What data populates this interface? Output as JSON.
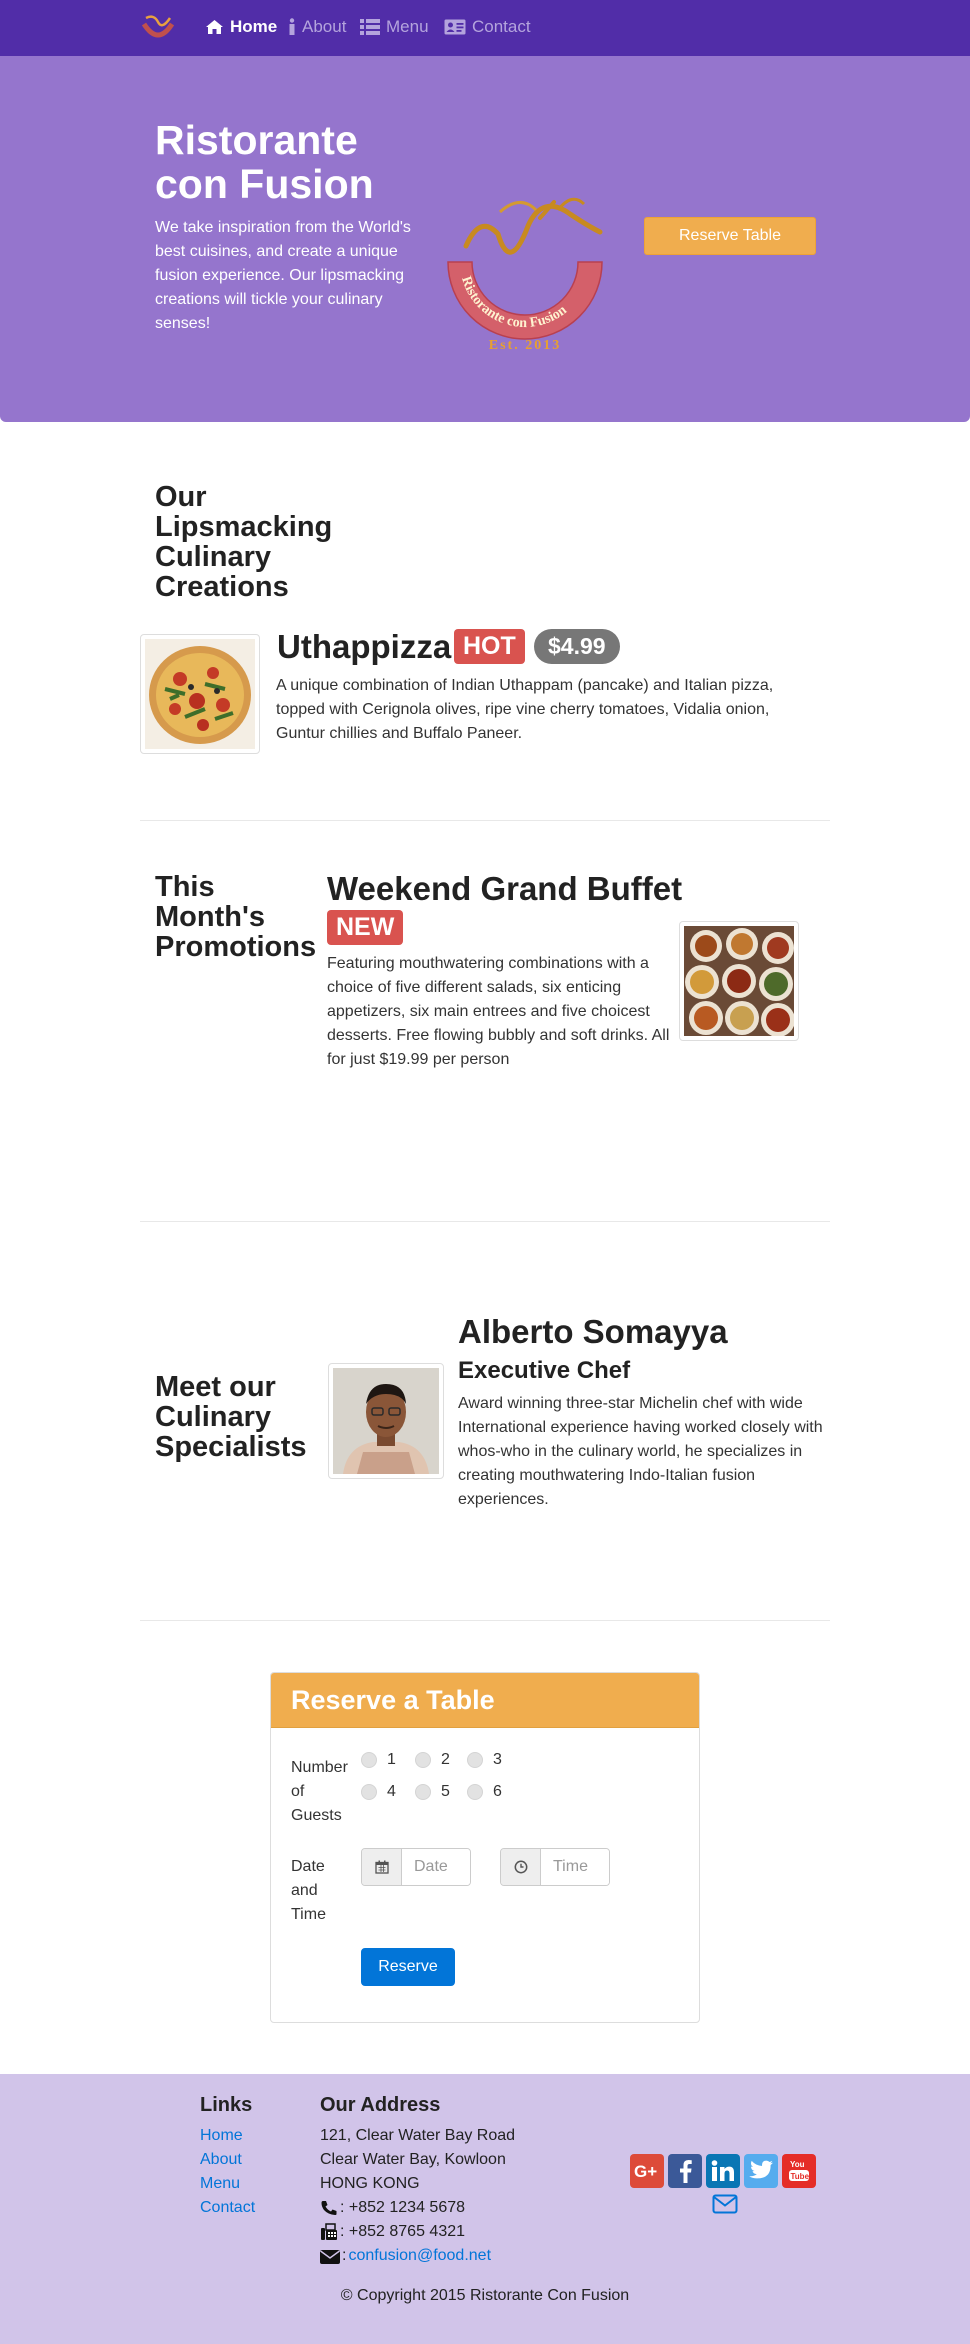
{
  "nav": {
    "items": [
      {
        "label": "Home",
        "icon": "home-icon"
      },
      {
        "label": "About",
        "icon": "info-icon"
      },
      {
        "label": "Menu",
        "icon": "list-icon"
      },
      {
        "label": "Contact",
        "icon": "address-card-icon"
      }
    ]
  },
  "jumbotron": {
    "title": "Ristorante con Fusion",
    "text": "We take inspiration from the World's best cuisines, and create a unique fusion experience. Our lipsmacking creations will tickle your culinary senses!",
    "logo_text": "Ristorante con Fusion",
    "logo_est": "Est. 2013",
    "reserve_label": "Reserve Table"
  },
  "creations": {
    "heading": "Our Lipsmacking Culinary Creations",
    "dish_name": "Uthappizza",
    "label": "HOT",
    "price": "$4.99",
    "description": "A unique combination of Indian Uthappam (pancake) and Italian pizza, topped with Cerignola olives, ripe vine cherry tomatoes, Vidalia onion, Guntur chillies and Buffalo Paneer."
  },
  "promotions": {
    "heading": "This Month's Promotions",
    "name": "Weekend Grand Buffet",
    "label": "NEW",
    "description": "Featuring mouthwatering combinations with a choice of five different salads, six enticing appetizers, six main entrees and five choicest desserts. Free flowing bubbly and soft drinks. All for just $19.99 per person"
  },
  "specialists": {
    "heading": "Meet our Culinary Specialists",
    "name": "Alberto Somayya",
    "role": "Executive Chef",
    "bio": "Award winning three-star Michelin chef with wide International experience having worked closely with whos-who in the culinary world, he specializes in creating mouthwatering Indo-Italian fusion experiences."
  },
  "reserve": {
    "title": "Reserve a Table",
    "guests_label": "Number of Guests",
    "guest_options": [
      "1",
      "2",
      "3",
      "4",
      "5",
      "6"
    ],
    "datetime_label": "Date and Time",
    "date_placeholder": "Date",
    "time_placeholder": "Time",
    "submit_label": "Reserve"
  },
  "footer": {
    "links_heading": "Links",
    "links": [
      "Home",
      "About",
      "Menu",
      "Contact"
    ],
    "address_heading": "Our Address",
    "address": [
      "121, Clear Water Bay Road",
      "Clear Water Bay, Kowloon",
      "HONG KONG"
    ],
    "phone": ": +852 1234 5678",
    "fax": ": +852 8765 4321",
    "email_prefix": ":",
    "email": "confusion@food.net",
    "social": [
      "google-plus-icon",
      "facebook-icon",
      "linkedin-icon",
      "twitter-icon",
      "youtube-icon",
      "envelope-icon"
    ],
    "copyright": "© Copyright 2015 Ristorante Con Fusion"
  },
  "colors": {
    "navbar": "#512da8",
    "jumbotron": "#9575cd",
    "footer": "#d1c4e9",
    "warning": "#f0ad4e",
    "danger": "#d9534f",
    "primary": "#0275d8"
  }
}
